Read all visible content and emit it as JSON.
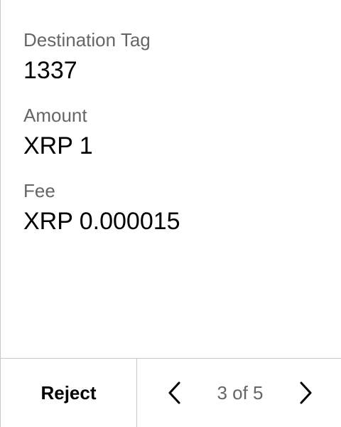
{
  "fields": [
    {
      "label": "Destination Tag",
      "value": "1337"
    },
    {
      "label": "Amount",
      "value": "XRP 1"
    },
    {
      "label": "Fee",
      "value": "XRP 0.000015"
    }
  ],
  "footer": {
    "reject_label": "Reject",
    "page_indicator": "3 of 5",
    "prev_icon": "chevron-left-icon",
    "next_icon": "chevron-right-icon"
  },
  "colors": {
    "label": "#666666",
    "value": "#000000",
    "divider": "#c8c8c8"
  }
}
